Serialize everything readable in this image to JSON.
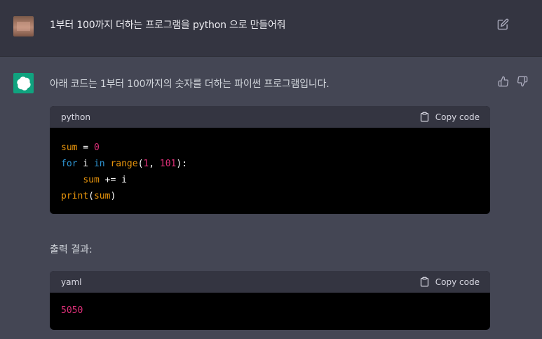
{
  "user_message": {
    "text": "1부터 100까지 더하는 프로그램을 python 으로 만들어줘",
    "avatar_icon": "user-avatar-photo",
    "edit_icon": "edit-icon"
  },
  "assistant_message": {
    "intro": "아래 코드는 1부터 100까지의 숫자를 더하는 파이썬 프로그램입니다.",
    "code_blocks": [
      {
        "language": "python",
        "copy_label": "Copy code",
        "lines": [
          "sum = 0",
          "for i in range(1, 101):",
          "    sum += i",
          "print(sum)"
        ]
      },
      {
        "language": "yaml",
        "copy_label": "Copy code",
        "lines": [
          "5050"
        ]
      }
    ],
    "output_label": "출력 결과:",
    "feedback": [
      "thumbs-up-icon",
      "thumbs-down-icon"
    ]
  },
  "colors": {
    "user_bg": "#343541",
    "assistant_bg": "#444654",
    "gpt_avatar": "#10a37f",
    "code_bg": "#000000",
    "code_header_bg": "#343541"
  }
}
